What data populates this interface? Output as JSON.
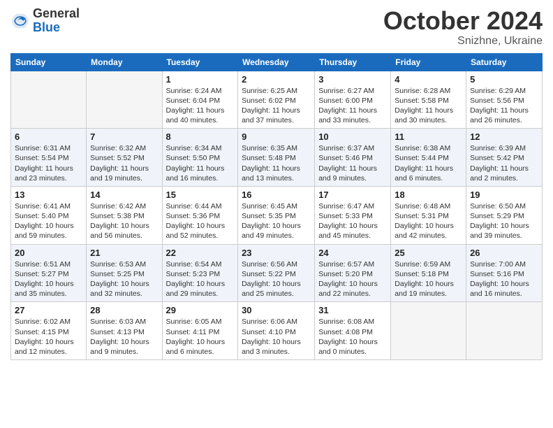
{
  "logo": {
    "general": "General",
    "blue": "Blue"
  },
  "title": {
    "month": "October 2024",
    "location": "Snizhne, Ukraine"
  },
  "days_of_week": [
    "Sunday",
    "Monday",
    "Tuesday",
    "Wednesday",
    "Thursday",
    "Friday",
    "Saturday"
  ],
  "weeks": [
    [
      {
        "day": "",
        "info": ""
      },
      {
        "day": "",
        "info": ""
      },
      {
        "day": "1",
        "info": "Sunrise: 6:24 AM\nSunset: 6:04 PM\nDaylight: 11 hours and 40 minutes."
      },
      {
        "day": "2",
        "info": "Sunrise: 6:25 AM\nSunset: 6:02 PM\nDaylight: 11 hours and 37 minutes."
      },
      {
        "day": "3",
        "info": "Sunrise: 6:27 AM\nSunset: 6:00 PM\nDaylight: 11 hours and 33 minutes."
      },
      {
        "day": "4",
        "info": "Sunrise: 6:28 AM\nSunset: 5:58 PM\nDaylight: 11 hours and 30 minutes."
      },
      {
        "day": "5",
        "info": "Sunrise: 6:29 AM\nSunset: 5:56 PM\nDaylight: 11 hours and 26 minutes."
      }
    ],
    [
      {
        "day": "6",
        "info": "Sunrise: 6:31 AM\nSunset: 5:54 PM\nDaylight: 11 hours and 23 minutes."
      },
      {
        "day": "7",
        "info": "Sunrise: 6:32 AM\nSunset: 5:52 PM\nDaylight: 11 hours and 19 minutes."
      },
      {
        "day": "8",
        "info": "Sunrise: 6:34 AM\nSunset: 5:50 PM\nDaylight: 11 hours and 16 minutes."
      },
      {
        "day": "9",
        "info": "Sunrise: 6:35 AM\nSunset: 5:48 PM\nDaylight: 11 hours and 13 minutes."
      },
      {
        "day": "10",
        "info": "Sunrise: 6:37 AM\nSunset: 5:46 PM\nDaylight: 11 hours and 9 minutes."
      },
      {
        "day": "11",
        "info": "Sunrise: 6:38 AM\nSunset: 5:44 PM\nDaylight: 11 hours and 6 minutes."
      },
      {
        "day": "12",
        "info": "Sunrise: 6:39 AM\nSunset: 5:42 PM\nDaylight: 11 hours and 2 minutes."
      }
    ],
    [
      {
        "day": "13",
        "info": "Sunrise: 6:41 AM\nSunset: 5:40 PM\nDaylight: 10 hours and 59 minutes."
      },
      {
        "day": "14",
        "info": "Sunrise: 6:42 AM\nSunset: 5:38 PM\nDaylight: 10 hours and 56 minutes."
      },
      {
        "day": "15",
        "info": "Sunrise: 6:44 AM\nSunset: 5:36 PM\nDaylight: 10 hours and 52 minutes."
      },
      {
        "day": "16",
        "info": "Sunrise: 6:45 AM\nSunset: 5:35 PM\nDaylight: 10 hours and 49 minutes."
      },
      {
        "day": "17",
        "info": "Sunrise: 6:47 AM\nSunset: 5:33 PM\nDaylight: 10 hours and 45 minutes."
      },
      {
        "day": "18",
        "info": "Sunrise: 6:48 AM\nSunset: 5:31 PM\nDaylight: 10 hours and 42 minutes."
      },
      {
        "day": "19",
        "info": "Sunrise: 6:50 AM\nSunset: 5:29 PM\nDaylight: 10 hours and 39 minutes."
      }
    ],
    [
      {
        "day": "20",
        "info": "Sunrise: 6:51 AM\nSunset: 5:27 PM\nDaylight: 10 hours and 35 minutes."
      },
      {
        "day": "21",
        "info": "Sunrise: 6:53 AM\nSunset: 5:25 PM\nDaylight: 10 hours and 32 minutes."
      },
      {
        "day": "22",
        "info": "Sunrise: 6:54 AM\nSunset: 5:23 PM\nDaylight: 10 hours and 29 minutes."
      },
      {
        "day": "23",
        "info": "Sunrise: 6:56 AM\nSunset: 5:22 PM\nDaylight: 10 hours and 25 minutes."
      },
      {
        "day": "24",
        "info": "Sunrise: 6:57 AM\nSunset: 5:20 PM\nDaylight: 10 hours and 22 minutes."
      },
      {
        "day": "25",
        "info": "Sunrise: 6:59 AM\nSunset: 5:18 PM\nDaylight: 10 hours and 19 minutes."
      },
      {
        "day": "26",
        "info": "Sunrise: 7:00 AM\nSunset: 5:16 PM\nDaylight: 10 hours and 16 minutes."
      }
    ],
    [
      {
        "day": "27",
        "info": "Sunrise: 6:02 AM\nSunset: 4:15 PM\nDaylight: 10 hours and 12 minutes."
      },
      {
        "day": "28",
        "info": "Sunrise: 6:03 AM\nSunset: 4:13 PM\nDaylight: 10 hours and 9 minutes."
      },
      {
        "day": "29",
        "info": "Sunrise: 6:05 AM\nSunset: 4:11 PM\nDaylight: 10 hours and 6 minutes."
      },
      {
        "day": "30",
        "info": "Sunrise: 6:06 AM\nSunset: 4:10 PM\nDaylight: 10 hours and 3 minutes."
      },
      {
        "day": "31",
        "info": "Sunrise: 6:08 AM\nSunset: 4:08 PM\nDaylight: 10 hours and 0 minutes."
      },
      {
        "day": "",
        "info": ""
      },
      {
        "day": "",
        "info": ""
      }
    ]
  ]
}
